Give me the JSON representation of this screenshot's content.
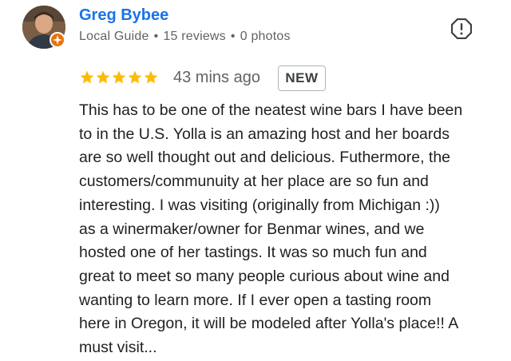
{
  "reviewer": {
    "name": "Greg Bybee",
    "badge": "Local Guide",
    "reviews": "15 reviews",
    "photos": "0 photos",
    "separator": "•",
    "avatar_icon": "person-avatar",
    "badge_icon": "local-guide-star-icon",
    "badge_color": "#e8710a"
  },
  "report": {
    "icon": "report-flag-icon"
  },
  "rating": {
    "stars": 5,
    "max": 5,
    "star_color": "#fbbc04"
  },
  "time_ago": "43 mins ago",
  "new_badge": "NEW",
  "review_lines": [
    "This has to be one of the neatest wine bars I have been",
    "to in the U.S. Yolla is an amazing host and her boards",
    "are so well thought out and delicious. Futhermore, the",
    "customers/communuity at her place are so fun and",
    "interesting. I was visiting (originally from Michigan :))",
    "as a winermaker/owner for Benmar wines, and we",
    "hosted one of her tastings. It was so much fun and",
    "great to meet so many people curious about wine and",
    "wanting to learn more. If I ever open a tasting room",
    "here in Oregon, it will be modeled after Yolla's place!! A",
    "must visit..."
  ],
  "colors": {
    "link": "#1a73e8",
    "secondary_text": "#5f6368",
    "text": "#202124"
  }
}
